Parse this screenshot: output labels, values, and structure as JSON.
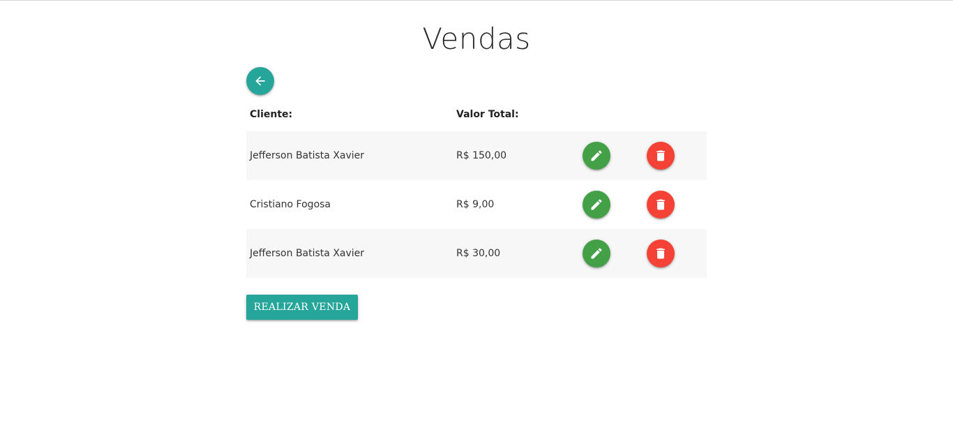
{
  "page": {
    "title": "Vendas"
  },
  "colors": {
    "primary": "#26a69a",
    "edit": "#43a047",
    "delete": "#f44336"
  },
  "icons": {
    "back": "arrow-left-icon",
    "edit": "pencil-icon",
    "delete": "trash-icon"
  },
  "table": {
    "headers": {
      "cliente": "Cliente:",
      "valor_total": "Valor Total:"
    },
    "rows": [
      {
        "cliente": "Jefferson Batista Xavier",
        "valor_total": "R$ 150,00"
      },
      {
        "cliente": "Cristiano Fogosa",
        "valor_total": "R$ 9,00"
      },
      {
        "cliente": "Jefferson Batista Xavier",
        "valor_total": "R$ 30,00"
      }
    ]
  },
  "actions": {
    "realizar_venda_label": "REALIZAR VENDA"
  }
}
